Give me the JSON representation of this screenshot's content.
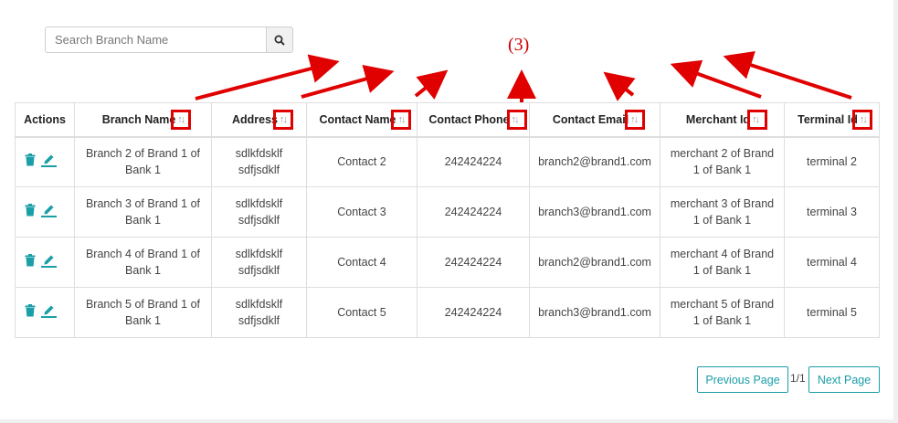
{
  "search": {
    "placeholder": "Search Branch Name",
    "icon": "search-icon"
  },
  "annotation": {
    "label": "(3)",
    "color": "#e00000"
  },
  "table": {
    "columns": [
      {
        "key": "actions",
        "label": "Actions",
        "sortable": false
      },
      {
        "key": "branch_name",
        "label": "Branch Name",
        "sortable": true
      },
      {
        "key": "address",
        "label": "Address",
        "sortable": true
      },
      {
        "key": "contact_name",
        "label": "Contact Name",
        "sortable": true
      },
      {
        "key": "contact_phone",
        "label": "Contact Phone",
        "sortable": true
      },
      {
        "key": "contact_email",
        "label": "Contact Email",
        "sortable": true
      },
      {
        "key": "merchant_id",
        "label": "Merchant Id",
        "sortable": true
      },
      {
        "key": "terminal_id",
        "label": "Terminal Id",
        "sortable": true
      }
    ],
    "sort_glyph": "↑↓",
    "rows": [
      {
        "branch_name": "Branch 2 of Brand 1 of Bank 1",
        "address": "sdlkfdsklf sdfjsdklf",
        "contact_name": "Contact 2",
        "contact_phone": "242424224",
        "contact_email": "branch2@brand1.com",
        "merchant_id": "merchant 2 of Brand 1 of Bank 1",
        "terminal_id": "terminal 2"
      },
      {
        "branch_name": "Branch 3 of Brand 1 of Bank 1",
        "address": "sdlkfdsklf sdfjsdklf",
        "contact_name": "Contact 3",
        "contact_phone": "242424224",
        "contact_email": "branch3@brand1.com",
        "merchant_id": "merchant 3 of Brand 1 of Bank 1",
        "terminal_id": "terminal 3"
      },
      {
        "branch_name": "Branch 4 of Brand 1 of Bank 1",
        "address": "sdlkfdsklf sdfjsdklf",
        "contact_name": "Contact 4",
        "contact_phone": "242424224",
        "contact_email": "branch2@brand1.com",
        "merchant_id": "merchant 4 of Brand 1 of Bank 1",
        "terminal_id": "terminal 4"
      },
      {
        "branch_name": "Branch 5 of Brand 1 of Bank 1",
        "address": "sdlkfdsklf sdfjsdklf",
        "contact_name": "Contact 5",
        "contact_phone": "242424224",
        "contact_email": "branch3@brand1.com",
        "merchant_id": "merchant 5 of Brand 1 of Bank 1",
        "terminal_id": "terminal 5"
      }
    ],
    "row_actions": [
      "delete-icon",
      "edit-icon"
    ]
  },
  "pagination": {
    "previous_label": "Previous Page",
    "page_info": "1/1",
    "next_label": "Next Page"
  },
  "colors": {
    "accent": "#1a9ea8",
    "highlight": "#e00000"
  }
}
